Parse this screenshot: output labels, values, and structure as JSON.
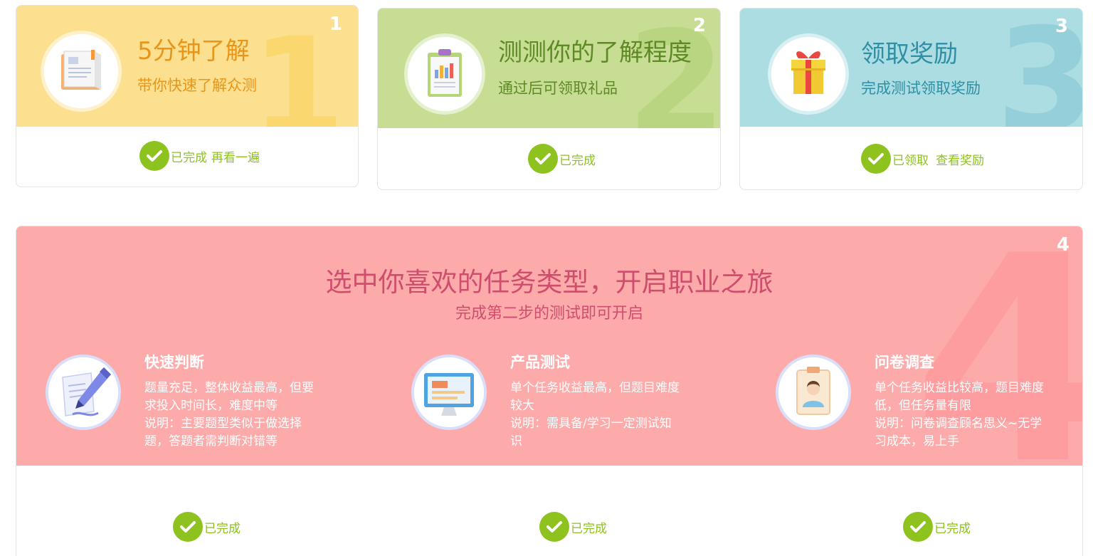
{
  "steps": [
    {
      "number": "1",
      "title": "5分钟了解",
      "subtitle": "带你快速了解众测",
      "icon": "book-icon",
      "status": "已完成",
      "link": "再看一遍",
      "colors": {
        "bg": "#fde08f",
        "accent": "#e7961a"
      }
    },
    {
      "number": "2",
      "title": "测测你的了解程度",
      "subtitle": "通过后可领取礼品",
      "icon": "clipboard-chart-icon",
      "status": "已完成",
      "link": "",
      "colors": {
        "bg": "#c6dd93",
        "accent": "#5e8a26"
      }
    },
    {
      "number": "3",
      "title": "领取奖励",
      "subtitle": "完成测试领取奖励",
      "icon": "gift-icon",
      "status": "已领取",
      "link": "查看奖励",
      "colors": {
        "bg": "#abdde3",
        "accent": "#2e8fa5"
      }
    }
  ],
  "journey": {
    "number": "4",
    "title": "选中你喜欢的任务类型，开启职业之旅",
    "subtitle": "完成第二步的测试即可开启",
    "colors": {
      "bg": "#fdaaaa",
      "accent": "#cf4e6d",
      "check": "#8dc21f"
    },
    "tasks": [
      {
        "name": "快速判断",
        "icon": "pen-paper-icon",
        "desc_lines": [
          "题量充足，整体收益最高，但要",
          "求投入时间长，难度中等",
          "说明：主要题型类似于做选择",
          "题，答题者需判断对错等"
        ],
        "status": "已完成"
      },
      {
        "name": "产品测试",
        "icon": "monitor-icon",
        "desc_lines": [
          "单个任务收益最高，但题目难度",
          "较大",
          "说明：需具备/学习一定测试知",
          "识"
        ],
        "status": "已完成"
      },
      {
        "name": "问卷调查",
        "icon": "id-badge-icon",
        "desc_lines": [
          "单个任务收益比较高，题目难度",
          "低，但任务量有限",
          "说明：问卷调查顾名思义~无学",
          "习成本，易上手"
        ],
        "status": "已完成"
      }
    ]
  }
}
